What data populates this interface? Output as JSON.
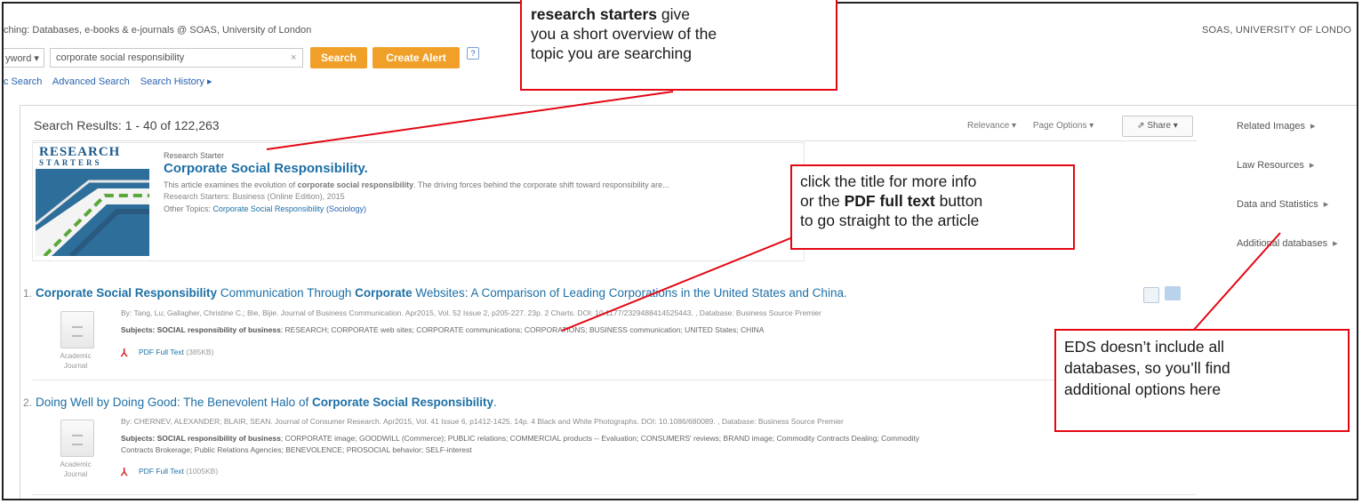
{
  "header": {
    "searching_text": "ching: Databases, e-books & e-journals @ SOAS, University of London",
    "institution": "SOAS, UNIVERSITY OF LONDO",
    "field_select": "yword",
    "query": "corporate social responsibility",
    "clear": "×",
    "search_label": "Search",
    "create_alert_label": "Create Alert",
    "help": "?",
    "links": [
      "c Search",
      "Advanced Search",
      "Search History ▸"
    ]
  },
  "results_header": {
    "count_text": "Search Results: 1 - 40 of 122,263",
    "relevance": "Relevance ▾",
    "page_options": "Page Options ▾",
    "share": "Share ▾"
  },
  "research_starter": {
    "logo_line1": "RESEARCH",
    "logo_line2": "STARTERS",
    "label": "Research Starter",
    "title": "Corporate Social Responsibility.",
    "description_prefix": "This article examines the evolution of ",
    "description_bold": "corporate social responsibility",
    "description_suffix": ". The driving forces behind the corporate shift toward responsibility are...",
    "source": "Research Starters: Business (Online Edition), 2015",
    "topics_label": "Other Topics: ",
    "topics_link": "Corporate Social Responsibility",
    "topics_paren": "(Sociology)"
  },
  "results": [
    {
      "num": "1.",
      "title_b1": "Corporate Social Responsibility",
      "title_t1": " Communication Through ",
      "title_b2": "Corporate",
      "title_t2": " Websites: A Comparison of Leading Corporations in the United States and China.",
      "meta": "By: Tang, Lu; Gallagher, Christine C.; Bie, Bijie. Journal of Business Communication. Apr2015, Vol. 52 Issue 2, p205-227. 23p. 2 Charts. DOI: 10.1177/2329488414525443. , Database: Business Source Premier",
      "subjects_label": "Subjects: SOCIAL responsibility of business",
      "subjects_text": "; RESEARCH; CORPORATE web sites; CORPORATE communications; CORPORATIONS; BUSINESS communication; UNITED States; CHINA",
      "pub_type_1": "Academic",
      "pub_type_2": "Journal",
      "pdf_label": "PDF Full Text",
      "pdf_size": "(385KB)"
    },
    {
      "num": "2.",
      "title_t0": "Doing Well by Doing Good: The Benevolent Halo of ",
      "title_b1": "Corporate Social Responsibility",
      "title_t1": ".",
      "meta": "By: CHERNEV, ALEXANDER; BLAIR, SEAN. Journal of Consumer Research. Apr2015, Vol. 41 Issue 6, p1412-1425. 14p. 4 Black and White Photographs. DOI: 10.1086/680089. , Database: Business Source Premier",
      "subjects_label": "Subjects: SOCIAL responsibility of business",
      "subjects_text": "; CORPORATE image; GOODWILL (Commerce); PUBLIC relations; COMMERCIAL products -- Evaluation; CONSUMERS' reviews; BRAND image; Commodity Contracts Dealing; Commodity",
      "subjects_line2": "Contracts Brokerage; Public Relations Agencies; BENEVOLENCE; PROSOCIAL behavior; SELF-interest",
      "pub_type_1": "Academic",
      "pub_type_2": "Journal",
      "pdf_label": "PDF Full Text",
      "pdf_size": "(1005KB)"
    }
  ],
  "right_rail": [
    "Related Images",
    "Law Resources",
    "Data and Statistics",
    "Additional databases"
  ],
  "callouts": {
    "c1_bold": "research starters",
    "c1_l1": " give",
    "c1_l2": "you a short overview of the",
    "c1_l3": "topic you are searching",
    "c2_l1": "click the title for more info",
    "c2_l2a": "or the ",
    "c2_l2b": "PDF full text",
    "c2_l2c": " button",
    "c2_l3": "to go straight to the article",
    "c3_l1": "EDS doesn’t include all",
    "c3_l2": "databases, so you’ll find",
    "c3_l3": "additional options here"
  },
  "colors": {
    "accent_orange": "#f0a028",
    "link_blue": "#1d6fa5",
    "callout_red": "#e30613"
  }
}
